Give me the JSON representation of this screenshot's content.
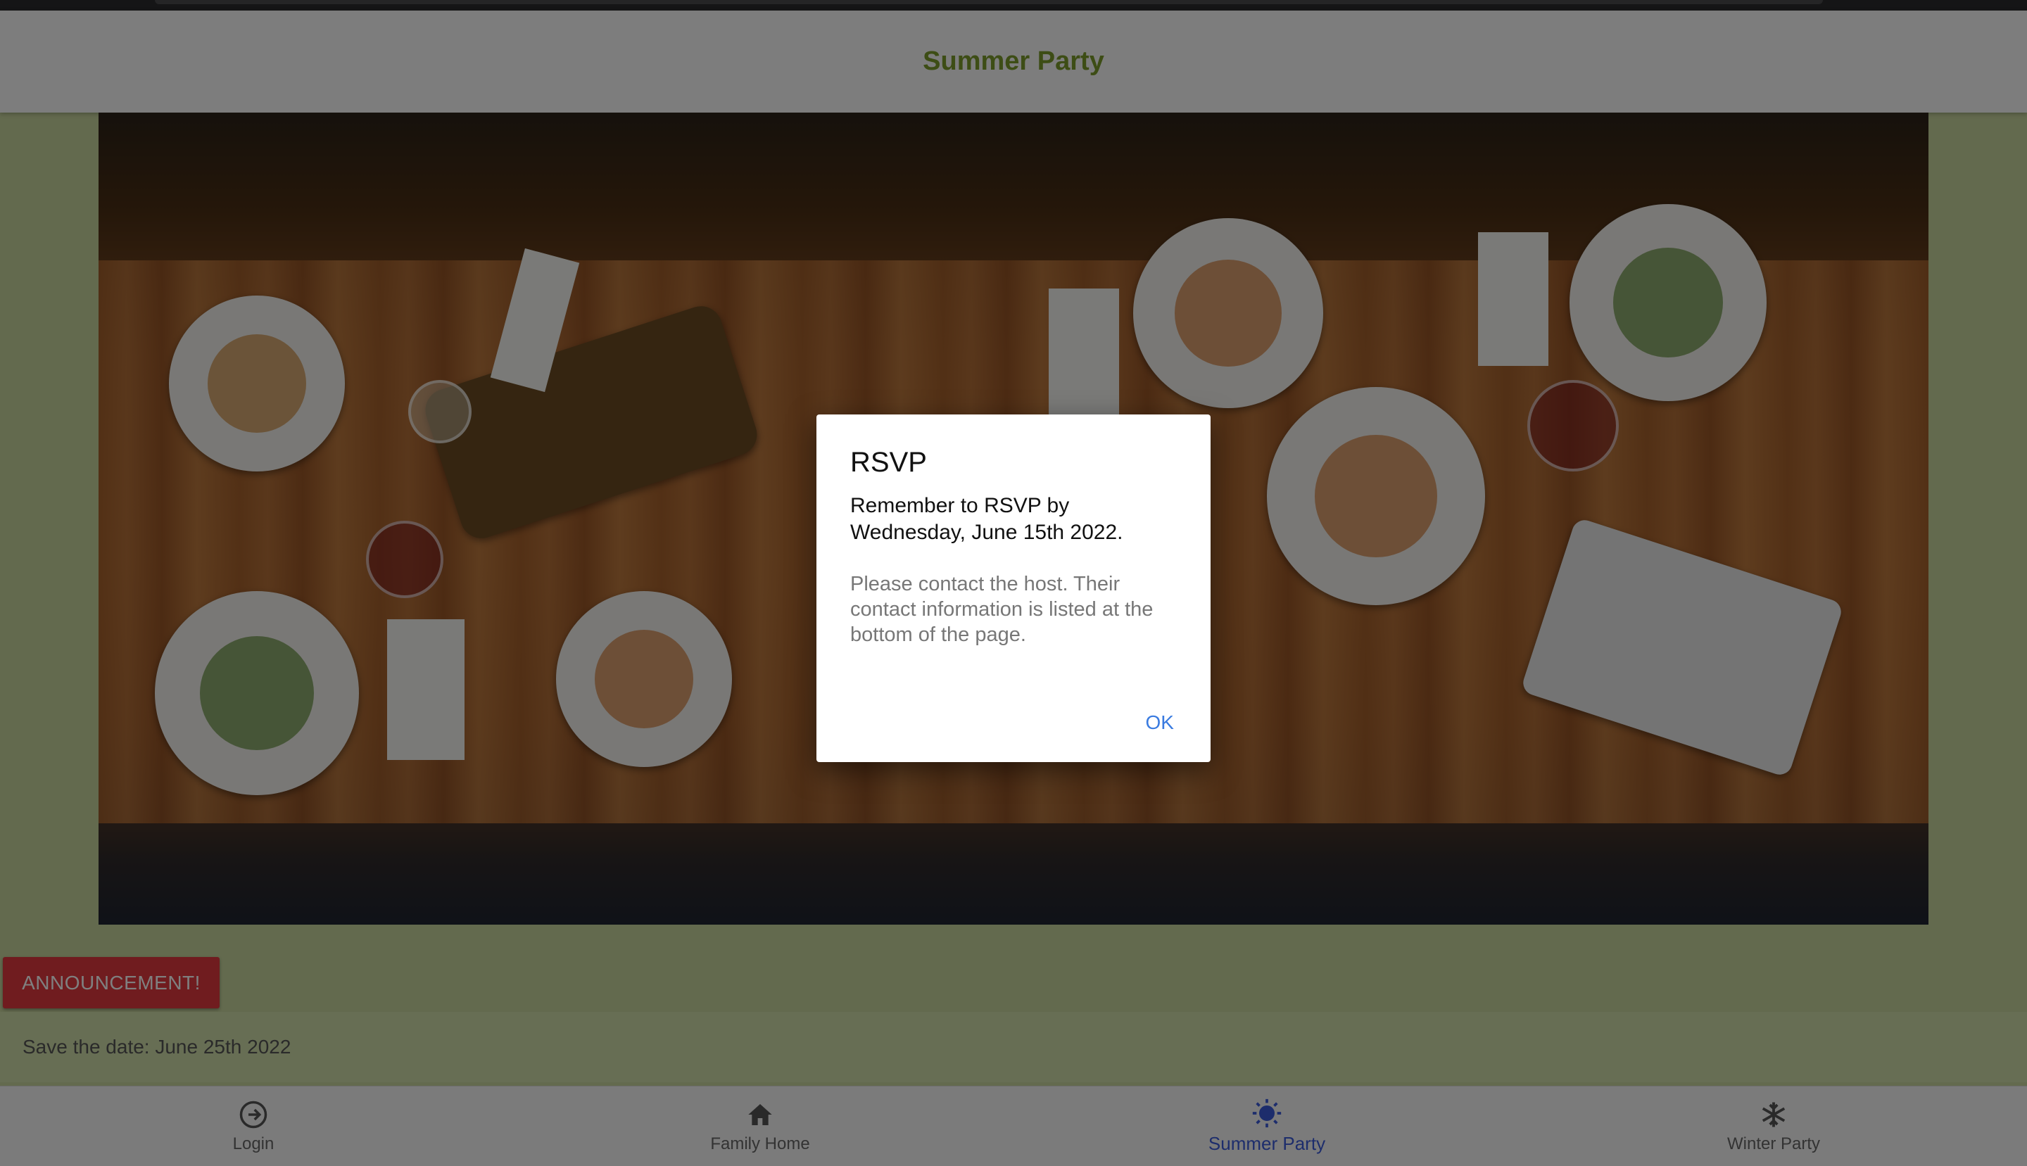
{
  "header": {
    "title": "Summer Party"
  },
  "announcement": {
    "button_label": "ANNOUNCEMENT!",
    "save_date_text": "Save the date: June 25th 2022"
  },
  "bottom_nav": {
    "items": [
      {
        "label": "Login",
        "icon": "login-icon",
        "active": false
      },
      {
        "label": "Family Home",
        "icon": "home-icon",
        "active": false
      },
      {
        "label": "Summer Party",
        "icon": "sun-icon",
        "active": true
      },
      {
        "label": "Winter Party",
        "icon": "snowflake-icon",
        "active": false
      }
    ]
  },
  "dialog": {
    "title": "RSVP",
    "message": "Remember to RSVP by Wednesday, June 15th 2022.",
    "detail": "Please contact the host. Their contact information is listed at the bottom of the page.",
    "ok_label": "OK"
  },
  "colors": {
    "header_title": "#7a9a2a",
    "page_background": "#c6d49c",
    "announcement_button": "#e0393e",
    "nav_active": "#3a5bd8",
    "dialog_ok": "#3a7be0"
  }
}
